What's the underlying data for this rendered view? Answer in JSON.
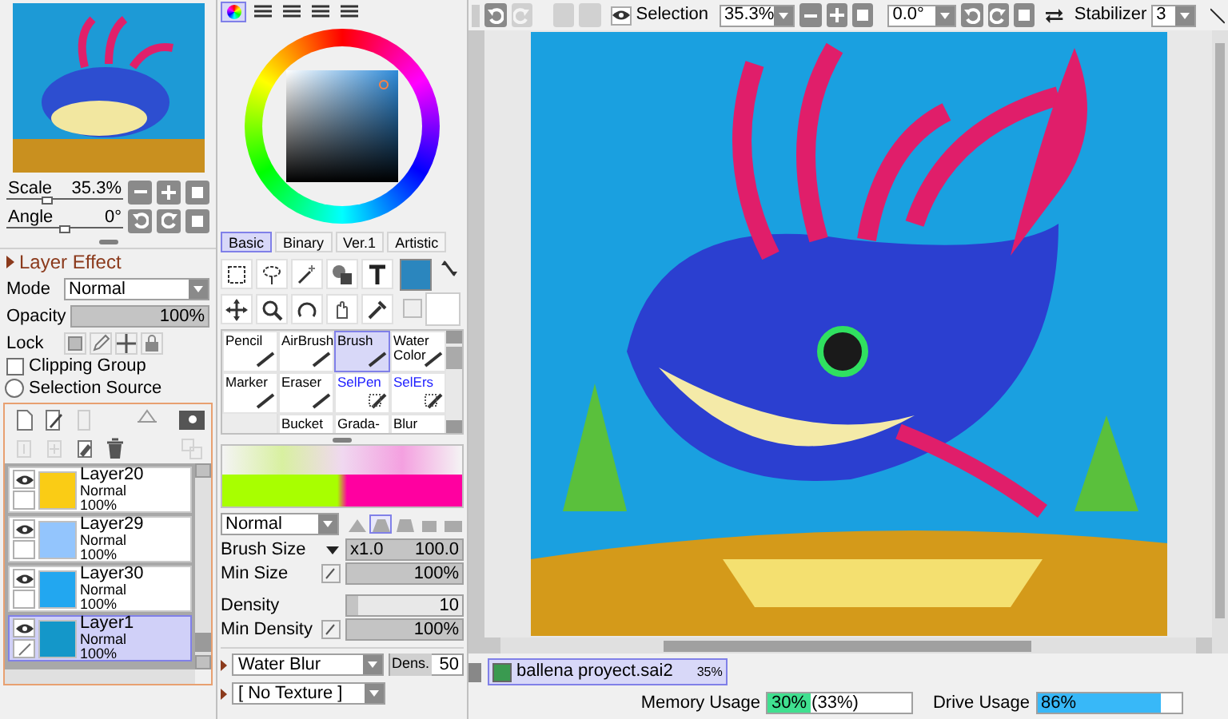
{
  "toolbar": {
    "selection_label": "Selection",
    "zoom": "35.3%",
    "angle": "0.0°",
    "stabilizer_label": "Stabilizer",
    "stabilizer": "3"
  },
  "navigator": {
    "scale": {
      "label": "Scale",
      "value": "35.3%",
      "level": 0.35
    },
    "angle": {
      "label": "Angle",
      "value": "0°",
      "level": 0.5
    }
  },
  "layer_effect": {
    "title": "Layer Effect",
    "expanded": false
  },
  "layer_props": {
    "mode_label": "Mode",
    "mode": "Normal",
    "opacity": {
      "label": "Opacity",
      "value": "100%",
      "level": 1
    },
    "lock_label": "Lock",
    "clipping_group": {
      "label": "Clipping Group",
      "checked": false
    },
    "selection_source": {
      "label": "Selection Source",
      "checked": false
    }
  },
  "layers": [
    {
      "name": "Layer20",
      "mode": "Normal",
      "opacity": "100%",
      "visible": true,
      "selected": false,
      "color": "#facc15"
    },
    {
      "name": "Layer29",
      "mode": "Normal",
      "opacity": "100%",
      "visible": true,
      "selected": false,
      "color": "#93c5fd"
    },
    {
      "name": "Layer30",
      "mode": "Normal",
      "opacity": "100%",
      "visible": true,
      "selected": false,
      "color": "#22a7f0"
    },
    {
      "name": "Layer1",
      "mode": "Normal",
      "opacity": "100%",
      "visible": true,
      "selected": true,
      "color": "#1497c9"
    }
  ],
  "palette_tabs": [
    {
      "label": "Basic",
      "selected": true
    },
    {
      "label": "Binary",
      "selected": false
    },
    {
      "label": "Ver.1",
      "selected": false
    },
    {
      "label": "Artistic",
      "selected": false
    }
  ],
  "tools": [
    {
      "label": "Pencil",
      "kind": "paint",
      "selected": false
    },
    {
      "label": "AirBrush",
      "kind": "paint",
      "selected": false
    },
    {
      "label": "Brush",
      "kind": "paint",
      "selected": true
    },
    {
      "label": "Water Color",
      "kind": "paint",
      "selected": false
    },
    {
      "label": "Marker",
      "kind": "paint",
      "selected": false
    },
    {
      "label": "Eraser",
      "kind": "paint",
      "selected": false
    },
    {
      "label": "SelPen",
      "kind": "selection",
      "selected": false
    },
    {
      "label": "SelErs",
      "kind": "selection",
      "selected": false
    },
    {
      "kind": "empty"
    },
    {
      "label": "Bucket",
      "kind": "paint",
      "selected": false
    },
    {
      "label": "Grada-",
      "kind": "paint",
      "selected": false
    },
    {
      "label": "Blur",
      "kind": "paint",
      "selected": false
    }
  ],
  "brush": {
    "blend": "Normal",
    "shapes": [
      {
        "selected": false
      },
      {
        "selected": true
      },
      {
        "selected": false
      },
      {
        "selected": false
      },
      {
        "selected": false
      }
    ],
    "settings": [
      {
        "label": "Brush Size",
        "kind": "size",
        "multiplier": "x1.0",
        "value": "100.0",
        "level": 1
      },
      {
        "label": "Min Size",
        "kind": "pressure",
        "value": "100%",
        "level": 1
      },
      {
        "label": "Density",
        "kind": "plain",
        "value": "10",
        "level": 0.1
      },
      {
        "label": "Min Density",
        "kind": "pressure",
        "value": "100%",
        "level": 1
      }
    ],
    "blending": "Water Blur",
    "dens_label": "Dens.",
    "dens": "50",
    "texture": "[ No Texture ]"
  },
  "document": {
    "name": "ballena proyect.sai2",
    "zoom": "35%",
    "selected": true
  },
  "status_bar": {
    "memory": {
      "label": "Memory Usage",
      "value": "30% (33%)",
      "level": 0.3
    },
    "drive": {
      "label": "Drive Usage",
      "value": "86%",
      "level": 0.86
    }
  }
}
